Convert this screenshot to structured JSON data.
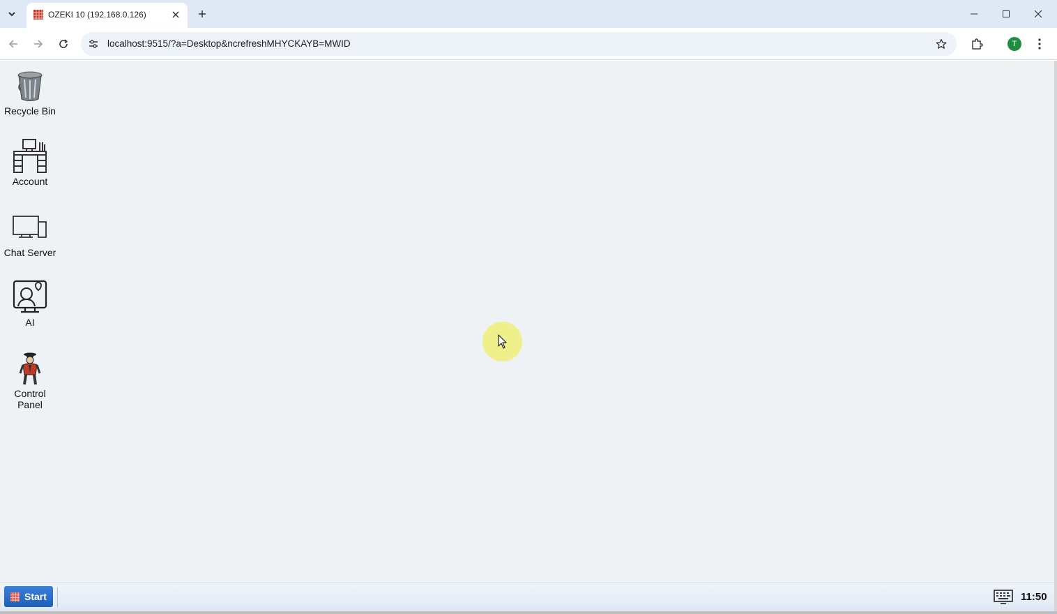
{
  "browser": {
    "tab": {
      "title": "OZEKI 10 (192.168.0.126)"
    },
    "address_bar": {
      "url": "localhost:9515/?a=Desktop&ncrefreshMHYCKAYB=MWID"
    },
    "profile_initial": "T",
    "icons": {
      "tab_menu": "chevron-down-icon",
      "tab_close": "close-icon",
      "new_tab": "plus-icon",
      "back": "arrow-left-icon",
      "forward": "arrow-right-icon",
      "reload": "reload-icon",
      "site_info": "tune-icon",
      "bookmark": "star-icon",
      "extensions": "puzzle-icon",
      "menu": "more-vert-icon"
    }
  },
  "desktop": {
    "icons": [
      {
        "label": "Recycle Bin",
        "icon": "recycle-bin-icon"
      },
      {
        "label": "Account",
        "icon": "account-desk-icon"
      },
      {
        "label": "Chat Server",
        "icon": "chat-server-icon"
      },
      {
        "label": "AI",
        "icon": "ai-monitor-icon"
      },
      {
        "label": "Control Panel",
        "icon": "control-panel-icon"
      }
    ]
  },
  "taskbar": {
    "start_label": "Start",
    "clock": "11:50"
  },
  "colors": {
    "desktop_bg": "#eef2f4",
    "start_button": "#2b6fcb",
    "titlebar": "#dfe9f6",
    "profile": "#1e8e3e"
  }
}
